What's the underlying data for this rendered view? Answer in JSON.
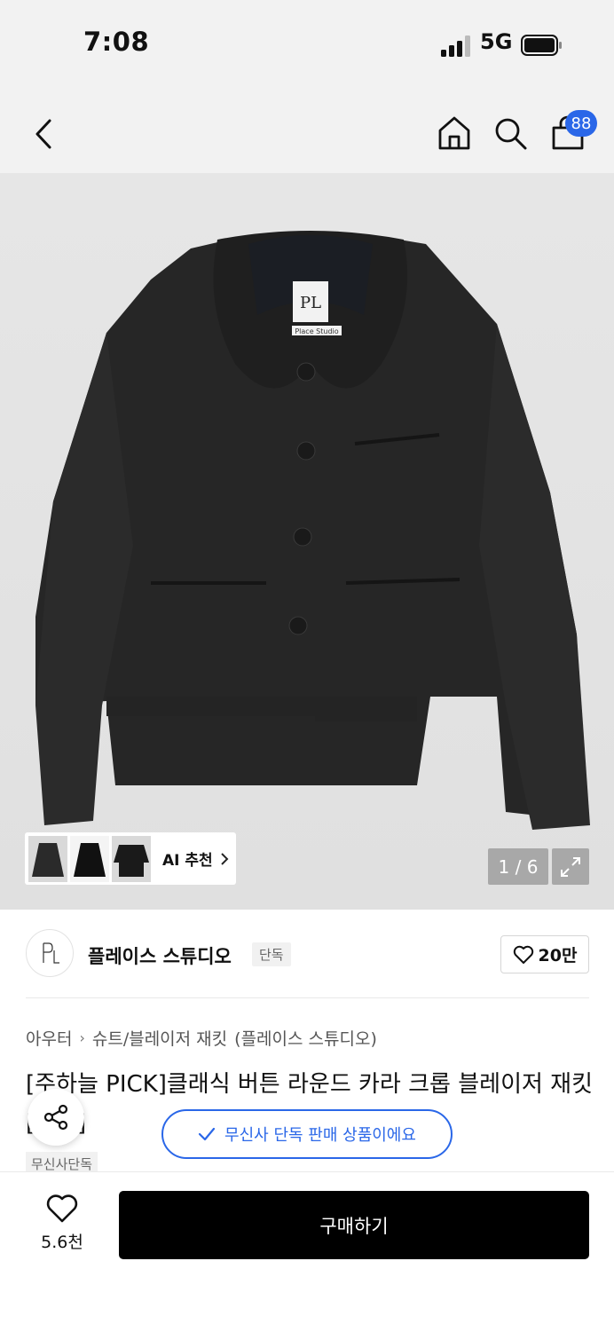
{
  "status_bar": {
    "time": "7:08",
    "network": "5G"
  },
  "nav": {
    "cart_count": "88"
  },
  "gallery": {
    "ai_label": "AI 추천",
    "page_indicator": "1 / 6",
    "tag_line_1": "Place Studio"
  },
  "brand": {
    "name": "플레이스 스튜디오",
    "badge": "단독",
    "like_count": "20만"
  },
  "breadcrumb": {
    "items": [
      "아우터",
      "슈트/블레이저 재킷",
      "(플레이스 스튜디오)"
    ]
  },
  "product": {
    "title": "[주하늘 PICK]클래식 버튼 라운드 카라 크롭 블레이저 재킷 [블랙]",
    "tag": "무신사단독"
  },
  "exclusive_notice": "무신사 단독 판매 상품이에요",
  "bottom_bar": {
    "wish_count": "5.6천",
    "buy_label": "구매하기"
  },
  "colors": {
    "accent": "#2a67e8",
    "buy": "#000000"
  }
}
